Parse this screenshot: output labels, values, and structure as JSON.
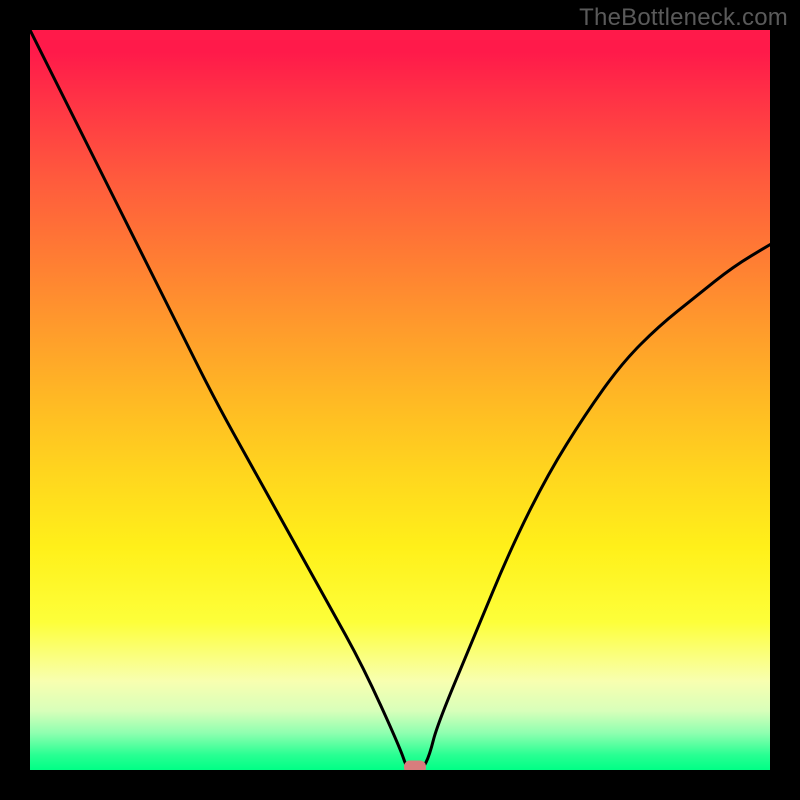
{
  "watermark": "TheBottleneck.com",
  "chart_data": {
    "type": "line",
    "title": "",
    "xlabel": "",
    "ylabel": "",
    "xlim": [
      0,
      100
    ],
    "ylim": [
      0,
      100
    ],
    "x": [
      0,
      5,
      10,
      15,
      20,
      25,
      30,
      35,
      40,
      45,
      50,
      51,
      52,
      53,
      54,
      55,
      60,
      65,
      70,
      75,
      80,
      85,
      90,
      95,
      100
    ],
    "values": [
      100,
      90,
      80,
      70,
      60,
      50,
      41,
      32,
      23,
      14,
      3,
      0,
      0,
      0,
      2,
      6,
      18,
      30,
      40,
      48,
      55,
      60,
      64,
      68,
      71
    ],
    "marker": {
      "x": 52,
      "y": 0
    },
    "gradient_stops": [
      {
        "pos": 0.0,
        "color": "#ff1a4a"
      },
      {
        "pos": 0.5,
        "color": "#ffd61e"
      },
      {
        "pos": 0.8,
        "color": "#fdff3a"
      },
      {
        "pos": 1.0,
        "color": "#00ff86"
      }
    ]
  }
}
